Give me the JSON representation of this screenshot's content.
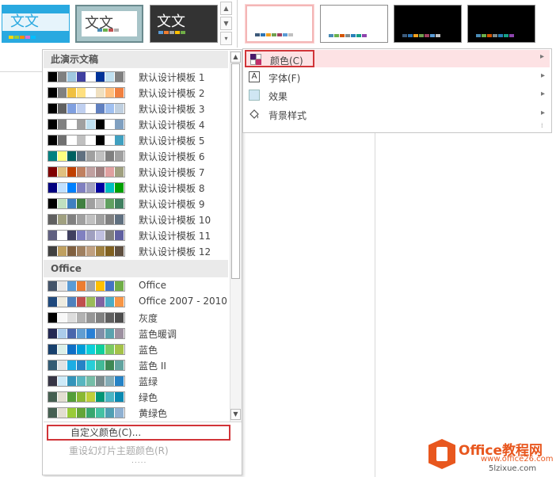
{
  "theme_gallery": {
    "thumbs": [
      {
        "text": "文文"
      },
      {
        "text": "文文"
      },
      {
        "text": "文文"
      }
    ]
  },
  "variants": [
    {
      "bg": "#ffffff",
      "strip": [
        "#3c5a7a",
        "#2e75b6",
        "#f0a020",
        "#70a050",
        "#a04060",
        "#5b9bd5",
        "#c0c0c0"
      ]
    },
    {
      "bg": "#ffffff",
      "strip": [
        "#4a8bb5",
        "#6ab04c",
        "#d35400",
        "#7f8c8d",
        "#2980b9",
        "#16a085",
        "#8e44ad"
      ]
    },
    {
      "bg": "#000000",
      "strip": [
        "#3c5a7a",
        "#2e75b6",
        "#f0a020",
        "#70a050",
        "#a04060",
        "#5b9bd5",
        "#c0c0c0"
      ]
    },
    {
      "bg": "#000000",
      "strip": [
        "#4a8bb5",
        "#6ab04c",
        "#d35400",
        "#7f8c8d",
        "#2980b9",
        "#16a085",
        "#8e44ad"
      ]
    }
  ],
  "dropdown": {
    "group1": "此演示文稿",
    "group2": "Office",
    "presentation_items": [
      {
        "label": "默认设计模板 1",
        "colors": [
          "#000000",
          "#808080",
          "#a0c8e0",
          "#4040a0",
          "#ffffff",
          "#003399",
          "#c0e0f0",
          "#808080"
        ]
      },
      {
        "label": "默认设计模板 2",
        "colors": [
          "#000000",
          "#808080",
          "#f0c040",
          "#ffe080",
          "#ffffff",
          "#f0e0c0",
          "#ffc080",
          "#f08040"
        ]
      },
      {
        "label": "默认设计模板 3",
        "colors": [
          "#000000",
          "#606060",
          "#80a0e0",
          "#c0d0f0",
          "#ffffff",
          "#6080c0",
          "#a0c0f0",
          "#c0d0e0"
        ]
      },
      {
        "label": "默认设计模板 4",
        "colors": [
          "#000000",
          "#808080",
          "#ffffff",
          "#a0a0a0",
          "#c0e0f0",
          "#000000",
          "#ffffff",
          "#80a0c0"
        ]
      },
      {
        "label": "默认设计模板 5",
        "colors": [
          "#000000",
          "#707070",
          "#ffffff",
          "#c0c0c0",
          "#ffffff",
          "#000000",
          "#ffffff",
          "#40a0c0"
        ]
      },
      {
        "label": "默认设计模板 6",
        "colors": [
          "#008080",
          "#ffff80",
          "#006060",
          "#607080",
          "#a0a0a0",
          "#c0c0c0",
          "#808080",
          "#a0a0a0"
        ]
      },
      {
        "label": "默认设计模板 7",
        "colors": [
          "#800000",
          "#e0c080",
          "#c04000",
          "#c08060",
          "#c0a0a0",
          "#a08080",
          "#e0a0a0",
          "#a0a080"
        ]
      },
      {
        "label": "默认设计模板 8",
        "colors": [
          "#000080",
          "#c0e0ff",
          "#0080ff",
          "#8080c0",
          "#a0a0c0",
          "#0000a0",
          "#00c0c0",
          "#00a000"
        ]
      },
      {
        "label": "默认设计模板 9",
        "colors": [
          "#000000",
          "#c0e0c0",
          "#4080c0",
          "#408040",
          "#a0a0a0",
          "#c0c0c0",
          "#60a060",
          "#408060"
        ]
      },
      {
        "label": "默认设计模板 10",
        "colors": [
          "#606060",
          "#a0a080",
          "#808080",
          "#a0a0a0",
          "#c0c0c0",
          "#a0a0a0",
          "#808080",
          "#607080"
        ]
      },
      {
        "label": "默认设计模板 11",
        "colors": [
          "#606080",
          "#ffffff",
          "#404060",
          "#8080c0",
          "#a0a0c0",
          "#c0c0e0",
          "#808080",
          "#6060a0"
        ]
      },
      {
        "label": "默认设计模板 12",
        "colors": [
          "#404040",
          "#c0a060",
          "#806040",
          "#a08060",
          "#c0a080",
          "#a08040",
          "#806020",
          "#605040"
        ]
      }
    ],
    "office_items": [
      {
        "label": "Office",
        "colors": [
          "#44546a",
          "#e7e6e6",
          "#5b9bd5",
          "#ed7d31",
          "#a5a5a5",
          "#ffc000",
          "#4472c4",
          "#70ad47"
        ]
      },
      {
        "label": "Office 2007 - 2010",
        "colors": [
          "#1f497d",
          "#eeece1",
          "#4f81bd",
          "#c0504d",
          "#9bbb59",
          "#8064a2",
          "#4bacc6",
          "#f79646"
        ]
      },
      {
        "label": "灰度",
        "colors": [
          "#000000",
          "#f8f8f8",
          "#dddddd",
          "#b2b2b2",
          "#969696",
          "#808080",
          "#5f5f5f",
          "#4d4d4d"
        ]
      },
      {
        "label": "蓝色暖调",
        "colors": [
          "#242852",
          "#acccea",
          "#4a66ac",
          "#629dd1",
          "#297fd5",
          "#7f8fa9",
          "#5aa2ae",
          "#9d90a0"
        ]
      },
      {
        "label": "蓝色",
        "colors": [
          "#17406d",
          "#dbefe9",
          "#0f6fc6",
          "#009dd9",
          "#0bd0d9",
          "#10cf9b",
          "#7cca62",
          "#a5c249"
        ]
      },
      {
        "label": "蓝色 II",
        "colors": [
          "#335b74",
          "#dfe3e5",
          "#1cade4",
          "#2683c6",
          "#27ced7",
          "#42ba97",
          "#3e8853",
          "#62a39f"
        ]
      },
      {
        "label": "蓝绿",
        "colors": [
          "#373545",
          "#ceeaf8",
          "#3494ba",
          "#58b6c0",
          "#75bda7",
          "#7a8c8e",
          "#84acb6",
          "#2683c6"
        ]
      },
      {
        "label": "绿色",
        "colors": [
          "#455f51",
          "#e3ded1",
          "#549e39",
          "#8ab833",
          "#c0cf3a",
          "#029676",
          "#4ab5c4",
          "#0989b1"
        ]
      },
      {
        "label": "黄绿色",
        "colors": [
          "#455f51",
          "#e3ded1",
          "#99cb38",
          "#63a537",
          "#37a76f",
          "#44c1a3",
          "#4e9fb3",
          "#8fb0d1"
        ]
      }
    ],
    "custom_colors": "自定义颜色(C)...",
    "reset_colors": "重设幻灯片主题颜色(R)",
    "more_dots": "....."
  },
  "right_menu": {
    "items": [
      {
        "label": "颜色(C)"
      },
      {
        "label": "字体(F)"
      },
      {
        "label": "效果"
      },
      {
        "label": "背景样式"
      }
    ],
    "arrow": "▸"
  },
  "watermark": {
    "line1": "Office教程网",
    "line2": "www.office26.com",
    "line3": "5lzixue.com"
  },
  "colors": {
    "highlight_red": "#d13438",
    "selected_bg": "#fde2e4",
    "logo_orange": "#e8571e"
  }
}
